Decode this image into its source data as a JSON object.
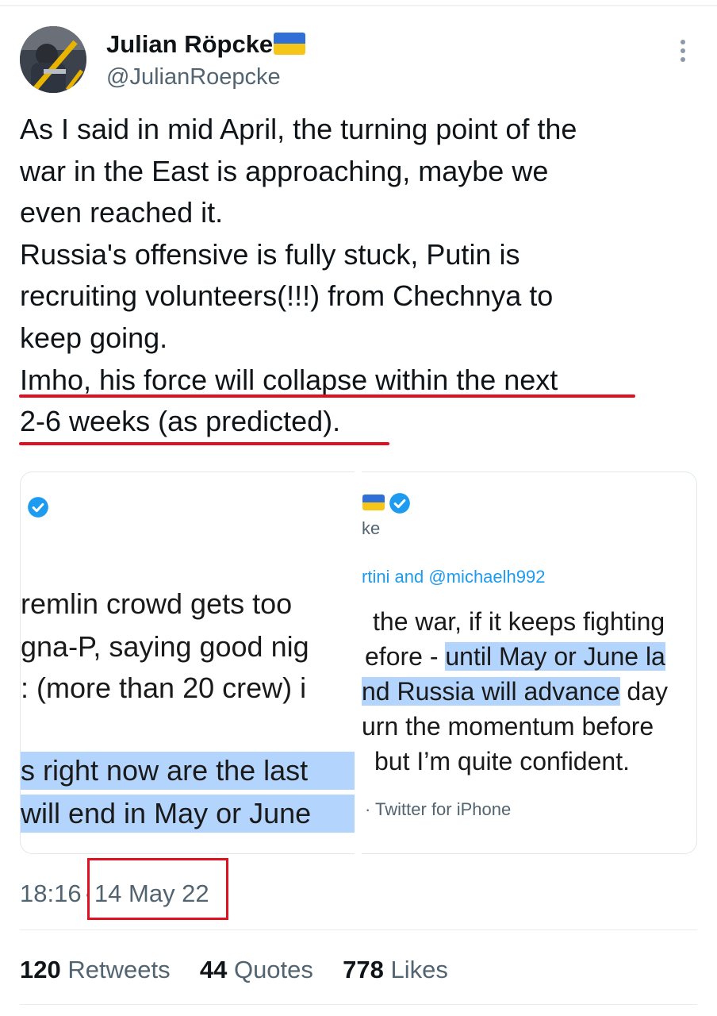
{
  "author": {
    "name": "Julian Röpcke",
    "handle": "@JulianRoepcke",
    "flag_icon": "ukraine-flag"
  },
  "tweet_text": {
    "lines": [
      "As I said in mid April, the turning point of the",
      "war in the East is approaching, maybe we",
      "even reached it.",
      "Russia's offensive is fully stuck, Putin is",
      "recruiting volunteers(!!!) from Chechnya to",
      "keep going.",
      "Imho, his force will collapse within the next",
      "2-6 weeks (as predicted)."
    ]
  },
  "embedded_left": {
    "lines": [
      "remlin crowd gets too",
      "gna-P, saying good nig",
      ": (more than 20 crew) i"
    ],
    "highlight_lines": [
      "s right now are the last",
      "will end in May or June"
    ]
  },
  "embedded_right": {
    "name_fragment": "ke",
    "reply_prefix": "rtini and ",
    "reply_handle": "@michaelh992",
    "line1": "the war, if it keeps fighting",
    "line2_plain": "efore - ",
    "line2_hl": "until May or June la",
    "line3_hl": "nd Russia will advance",
    "line3_plain": " day",
    "line4": "urn the momentum before",
    "line5": "but I’m quite confident.",
    "source": "· Twitter for iPhone"
  },
  "meta": {
    "time": "18:16",
    "dot": "·",
    "date": "14 May 22"
  },
  "stats": {
    "retweets_count": "120",
    "retweets_label": "Retweets",
    "quotes_count": "44",
    "quotes_label": "Quotes",
    "likes_count": "778",
    "likes_label": "Likes"
  },
  "colors": {
    "annotation_red": "#e01020",
    "highlight_blue": "#b3d4fc",
    "twitter_blue": "#1d9bf0",
    "muted": "#536471"
  }
}
